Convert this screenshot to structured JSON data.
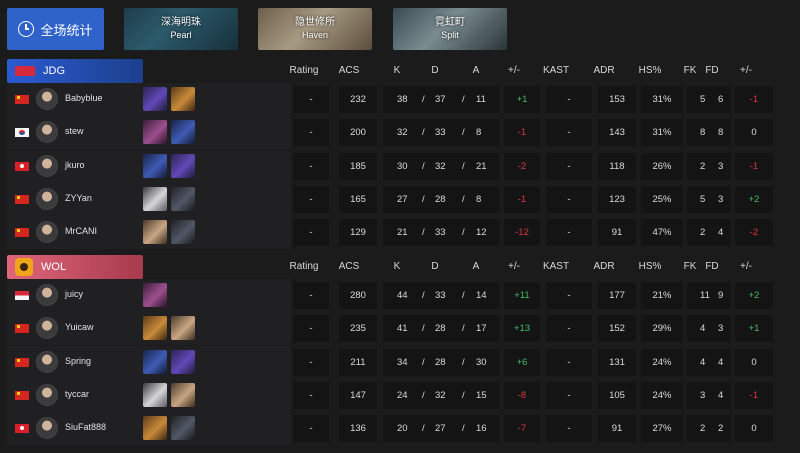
{
  "overall_button": {
    "label": "全场统计",
    "icon": "clock-icon"
  },
  "maps": [
    {
      "cn": "深海明珠",
      "en": "Pearl"
    },
    {
      "cn": "隐世修所",
      "en": "Haven"
    },
    {
      "cn": "霓虹町",
      "en": "Split"
    }
  ],
  "headers": {
    "rating": "Rating",
    "acs": "ACS",
    "k": "K",
    "d": "D",
    "a": "A",
    "pm": "+/-",
    "kast": "KAST",
    "adr": "ADR",
    "hs": "HS%",
    "fk": "FK",
    "fd": "FD",
    "fpm": "+/-"
  },
  "teams": [
    {
      "name": "JDG",
      "accent": "#2b5bd1",
      "players": [
        {
          "flag": "cn",
          "name": "Babyblue",
          "agents": [
            "purple",
            "orange"
          ],
          "rating": "-",
          "acs": "232",
          "k": "38",
          "d": "37",
          "a": "11",
          "pm": "+1",
          "pm_class": "pos",
          "kast": "-",
          "adr": "153",
          "hs": "31%",
          "fk": "5",
          "fd": "6",
          "fpm": "-1",
          "fpm_class": "neg"
        },
        {
          "flag": "kr",
          "name": "stew",
          "agents": [
            "pink",
            "blue"
          ],
          "rating": "-",
          "acs": "200",
          "k": "32",
          "d": "33",
          "a": "8",
          "pm": "-1",
          "pm_class": "neg",
          "kast": "-",
          "adr": "143",
          "hs": "31%",
          "fk": "8",
          "fd": "8",
          "fpm": "0",
          "fpm_class": "zero"
        },
        {
          "flag": "hk",
          "name": "jkuro",
          "agents": [
            "blue",
            "purple"
          ],
          "rating": "-",
          "acs": "185",
          "k": "30",
          "d": "32",
          "a": "21",
          "pm": "-2",
          "pm_class": "neg",
          "kast": "-",
          "adr": "118",
          "hs": "26%",
          "fk": "2",
          "fd": "3",
          "fpm": "-1",
          "fpm_class": "neg"
        },
        {
          "flag": "cn",
          "name": "ZYYan",
          "agents": [
            "white",
            "dark"
          ],
          "rating": "-",
          "acs": "165",
          "k": "27",
          "d": "28",
          "a": "8",
          "pm": "-1",
          "pm_class": "neg",
          "kast": "-",
          "adr": "123",
          "hs": "25%",
          "fk": "5",
          "fd": "3",
          "fpm": "+2",
          "fpm_class": "pos"
        },
        {
          "flag": "cn",
          "name": "MrCANI",
          "agents": [
            "tan",
            "dark"
          ],
          "rating": "-",
          "acs": "129",
          "k": "21",
          "d": "33",
          "a": "12",
          "pm": "-12",
          "pm_class": "neg",
          "kast": "-",
          "adr": "91",
          "hs": "47%",
          "fk": "2",
          "fd": "4",
          "fpm": "-2",
          "fpm_class": "neg"
        }
      ]
    },
    {
      "name": "WOL",
      "accent": "#e0667a",
      "players": [
        {
          "flag": "sg",
          "name": "juicy",
          "agents": [
            "pink"
          ],
          "rating": "-",
          "acs": "280",
          "k": "44",
          "d": "33",
          "a": "14",
          "pm": "+11",
          "pm_class": "pos",
          "kast": "-",
          "adr": "177",
          "hs": "21%",
          "fk": "11",
          "fd": "9",
          "fpm": "+2",
          "fpm_class": "pos"
        },
        {
          "flag": "cn",
          "name": "Yuicaw",
          "agents": [
            "orange",
            "tan"
          ],
          "rating": "-",
          "acs": "235",
          "k": "41",
          "d": "28",
          "a": "17",
          "pm": "+13",
          "pm_class": "pos",
          "kast": "-",
          "adr": "152",
          "hs": "29%",
          "fk": "4",
          "fd": "3",
          "fpm": "+1",
          "fpm_class": "pos"
        },
        {
          "flag": "cn",
          "name": "Spring",
          "agents": [
            "blue",
            "purple"
          ],
          "rating": "-",
          "acs": "211",
          "k": "34",
          "d": "28",
          "a": "30",
          "pm": "+6",
          "pm_class": "pos",
          "kast": "-",
          "adr": "131",
          "hs": "24%",
          "fk": "4",
          "fd": "4",
          "fpm": "0",
          "fpm_class": "zero"
        },
        {
          "flag": "cn",
          "name": "tyccar",
          "agents": [
            "white",
            "tan"
          ],
          "rating": "-",
          "acs": "147",
          "k": "24",
          "d": "32",
          "a": "15",
          "pm": "-8",
          "pm_class": "neg",
          "kast": "-",
          "adr": "105",
          "hs": "24%",
          "fk": "3",
          "fd": "4",
          "fpm": "-1",
          "fpm_class": "neg"
        },
        {
          "flag": "hk",
          "name": "SiuFat888",
          "agents": [
            "orange",
            "dark"
          ],
          "rating": "-",
          "acs": "136",
          "k": "20",
          "d": "27",
          "a": "16",
          "pm": "-7",
          "pm_class": "neg",
          "kast": "-",
          "adr": "91",
          "hs": "27%",
          "fk": "2",
          "fd": "2",
          "fpm": "0",
          "fpm_class": "zero"
        }
      ]
    }
  ]
}
